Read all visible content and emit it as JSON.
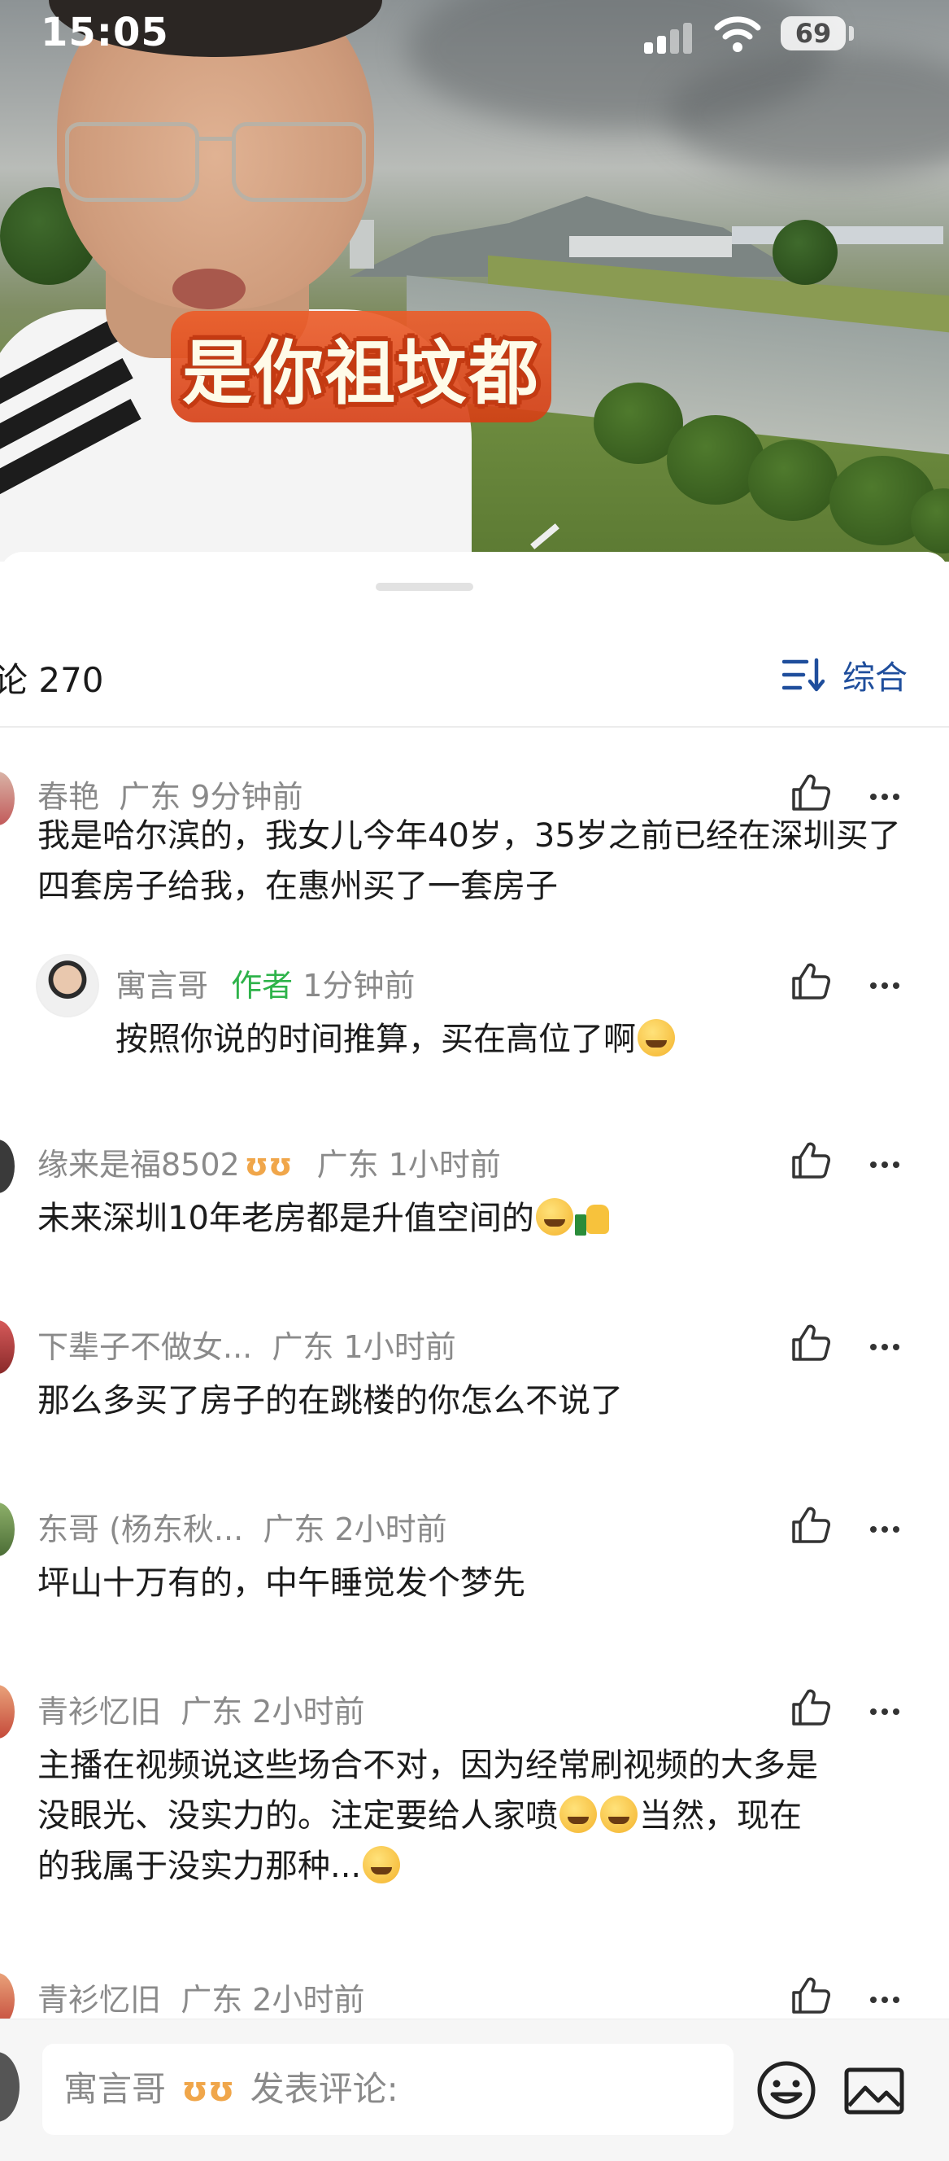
{
  "status_bar": {
    "time": "15:05",
    "battery": "69"
  },
  "video": {
    "overlay_caption": "是你祖坟都"
  },
  "comments_header": {
    "count_label": "论 270",
    "sort_label": "综合"
  },
  "comments": [
    {
      "user": "春艳",
      "location": "广东",
      "time": "9分钟前",
      "text": "我是哈尔滨的，我女儿今年40岁，35岁之前已经在深圳买了四套房子给我，在惠州买了一套房子",
      "reply": {
        "user": "寓言哥",
        "role": "作者",
        "time": "1分钟前",
        "text": "按照你说的时间推算，买在高位了啊"
      }
    },
    {
      "user": "缘来是福8502",
      "location": "广东",
      "time": "1小时前",
      "text": "未来深圳10年老房都是升值空间的"
    },
    {
      "user": "下辈子不做女...",
      "location": "广东",
      "time": "1小时前",
      "text": "那么多买了房子的在跳楼的你怎么不说了"
    },
    {
      "user": "东哥 (杨东秋...",
      "location": "广东",
      "time": "2小时前",
      "text": "坪山十万有的，中午睡觉发个梦先"
    },
    {
      "user": "青衫忆旧",
      "location": "广东",
      "time": "2小时前",
      "text_lines": [
        "主播在视频说这些场合不对，因为经常刷视频的大多是",
        "没眼光、没实力的。注定要给人家喷",
        "当然，现在",
        "的我属于没实力那种..."
      ]
    },
    {
      "user": "青衫忆旧",
      "location": "广东",
      "time": "2小时前"
    }
  ],
  "input_bar": {
    "user": "寓言哥",
    "placeholder": "发表评论:"
  },
  "colors": {
    "accent_blue": "#1f4e9c",
    "author_green": "#2eb34a",
    "badge_orange": "#f0a64a"
  }
}
